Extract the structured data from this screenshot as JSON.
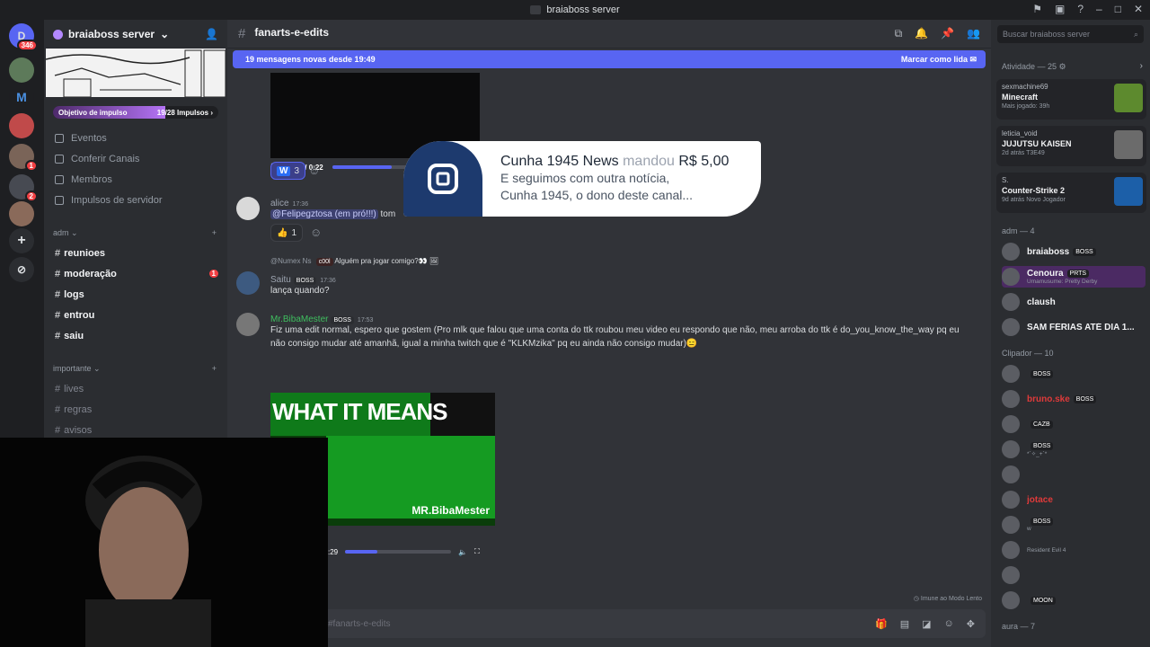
{
  "window": {
    "title": "braiaboss server"
  },
  "servers": [
    {
      "label": "D",
      "badge": "346"
    },
    {
      "label": "",
      "badge": ""
    },
    {
      "label": "M",
      "badge": ""
    },
    {
      "label": "",
      "badge": ""
    },
    {
      "label": "",
      "badge": "1"
    },
    {
      "label": "",
      "badge": "2"
    },
    {
      "label": "",
      "badge": ""
    },
    {
      "label": "+",
      "badge": ""
    },
    {
      "label": "⊘",
      "badge": ""
    }
  ],
  "guild": {
    "name": "braiaboss server",
    "boost_label": "Objetivo de impulso",
    "boost_count": "19/28 Impulsos",
    "boost_progress": 0.68
  },
  "menu": [
    "Eventos",
    "Conferir Canais",
    "Membros",
    "Impulsos de servidor"
  ],
  "categories": [
    {
      "name": "adm",
      "channels": [
        {
          "name": "reunioes",
          "badge": ""
        },
        {
          "name": "moderação",
          "badge": "1"
        },
        {
          "name": "logs",
          "badge": ""
        },
        {
          "name": "entrou",
          "badge": ""
        },
        {
          "name": "saiu",
          "badge": ""
        }
      ]
    },
    {
      "name": "importante",
      "channels": [
        {
          "name": "lives",
          "badge": ""
        },
        {
          "name": "regras",
          "badge": ""
        },
        {
          "name": "avisos",
          "badge": ""
        }
      ]
    }
  ],
  "channel": {
    "name": "fanarts-e-edits"
  },
  "newbar": {
    "text": "19 mensagens novas desde 19:49",
    "action": "Marcar como lida"
  },
  "video1": {
    "time": "0:22 / 0:22",
    "progress": 0.55
  },
  "reactions1": [
    {
      "emoji": "W",
      "count": "3"
    }
  ],
  "donation": {
    "sender": "Cunha 1945 News",
    "verb": "mandou",
    "amount": "R$ 5,00",
    "line2": "E seguimos com outra notícia,",
    "line3": "Cunha 1945, o dono deste canal..."
  },
  "messages": [
    {
      "author": "alice",
      "time": "17:36",
      "mention": "@Felipegztosa (em pró!!!)",
      "text": "tom",
      "reaction": "1"
    },
    {
      "reply_author": "@Numex Ns",
      "reply_tag": "c00l",
      "reply_text": "Alguém pra jogar comigo?👀 🖼",
      "author": "Saitu",
      "tag": "BOSS",
      "time": "17:36",
      "text": "lança quando?"
    },
    {
      "author": "Mr.BibaMester",
      "tag": "BOSS",
      "time": "17:53",
      "text": "Fiz uma edit normal, espero que gostem  (Pro mlk que falou que uma conta do ttk roubou meu video eu respondo que não, meu arroba do ttk é do_you_know_the_way pq eu não consigo mudar até amanhã, igual a minha twitch que é \"KLKMzika\" pq eu ainda não consigo mudar)😑"
    }
  ],
  "video2": {
    "overlay_top": "WHAT IT MEANS",
    "overlay_bottom": "MR.BibaMester",
    "time": ":29",
    "progress": 0.3
  },
  "footer": {
    "slowmode": "Imune ao Modo Lento"
  },
  "composer": {
    "placeholder": "#fanarts-e-edits"
  },
  "search": {
    "placeholder": "Buscar braiaboss server"
  },
  "activity": {
    "header": "Atividade — 25",
    "items": [
      {
        "user": "sexmachine69",
        "game": "Minecraft",
        "sub": "Mais jogado: 39h",
        "color": "#5d8a2e"
      },
      {
        "user": "leticia_void",
        "game": "JUJUTSU KAISEN",
        "sub": "2d atrás  T3E49",
        "color": "#6b6b6b"
      },
      {
        "user": "S.",
        "game": "Counter-Strike 2",
        "sub": "9d atrás  Novo Jogador",
        "color": "#1c5fa8"
      }
    ]
  },
  "member_groups": [
    {
      "header": "adm — 4",
      "members": [
        {
          "name": "braiaboss",
          "tag": "BOSS",
          "sub": "",
          "color": "#f2f3f5",
          "hl": false
        },
        {
          "name": "Cenoura",
          "tag": "PRTS",
          "sub": "Umamusume: Pretty Derby",
          "color": "#f2f3f5",
          "hl": true
        },
        {
          "name": "claush",
          "tag": "",
          "sub": "",
          "color": "#f2f3f5",
          "hl": false
        },
        {
          "name": "SAM FÉRIAS ATÉ DIA 1...",
          "tag": "",
          "sub": "",
          "color": "#f2f3f5",
          "hl": false
        }
      ]
    },
    {
      "header": "Clipador — 10",
      "members": [
        {
          "name": "",
          "tag": "BOSS",
          "sub": "",
          "color": "#f2f3f5",
          "hl": false
        },
        {
          "name": "bruno.ske",
          "tag": "BOSS",
          "sub": "",
          "color": "#e03a3a",
          "hl": false
        },
        {
          "name": "",
          "tag": "CAZB",
          "sub": "",
          "color": "#f2f3f5",
          "hl": false
        },
        {
          "name": "",
          "tag": "BOSS",
          "sub": "*`✧_+`*",
          "color": "#f2f3f5",
          "hl": false
        },
        {
          "name": "",
          "tag": "",
          "sub": "",
          "color": "#f2f3f5",
          "hl": false
        },
        {
          "name": "jotace",
          "tag": "",
          "sub": "",
          "color": "#e03a3a",
          "hl": false
        },
        {
          "name": "",
          "tag": "BOSS",
          "sub": "w",
          "color": "#f2f3f5",
          "hl": false
        },
        {
          "name": "",
          "tag": "",
          "sub": "Resident Evil 4",
          "color": "#f2f3f5",
          "hl": false
        },
        {
          "name": "",
          "tag": "",
          "sub": "",
          "color": "#f2f3f5",
          "hl": false
        },
        {
          "name": "",
          "tag": "MOON",
          "sub": "",
          "color": "#f2f3f5",
          "hl": false
        }
      ]
    },
    {
      "header": "aura — 7",
      "members": []
    }
  ]
}
